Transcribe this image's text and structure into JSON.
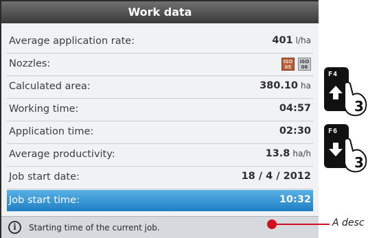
{
  "screen": {
    "title": "Work data",
    "rows": [
      {
        "label": "Average application rate:",
        "value": "401",
        "unit": "l/ha"
      },
      {
        "label": "Nozzles:"
      },
      {
        "label": "Calculated area:",
        "value": "380.10",
        "unit": "ha"
      },
      {
        "label": "Working time:",
        "value": "04:57"
      },
      {
        "label": "Application time:",
        "value": "02:30"
      },
      {
        "label": "Average productivity:",
        "value": "13.8",
        "unit": "ha/h"
      },
      {
        "label": "Job start date:",
        "value": "18 / 4 / 2012"
      },
      {
        "label": "Job start time:",
        "value": "10:32"
      }
    ],
    "nozzles": [
      {
        "line1": "ISO",
        "line2": "05",
        "color": "#b5603a"
      },
      {
        "line1": "ISO",
        "line2": "06",
        "color": "#c8ccd2"
      }
    ],
    "footer": {
      "icon": "info-icon",
      "text": "Starting time of the current job."
    }
  },
  "keys": [
    {
      "label": "F4",
      "icon": "arrow-up-icon",
      "press_count": "3"
    },
    {
      "label": "F6",
      "icon": "arrow-down-icon",
      "press_count": "3"
    }
  ],
  "callout": {
    "text": "A desc",
    "color": "#d01020"
  },
  "colors": {
    "selected_row": "#2d8fd3",
    "title_bar": "#4a4a4a",
    "background": "#f1f2f4"
  }
}
